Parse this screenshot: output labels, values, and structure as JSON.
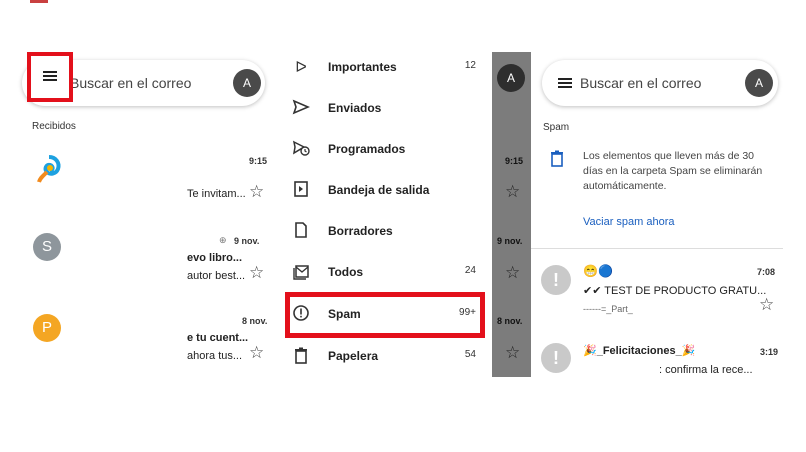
{
  "panel1": {
    "search_placeholder": "Buscar en el correo",
    "avatar": "A",
    "section": "Recibidos",
    "messages": [
      {
        "avatar": "",
        "time": "9:15",
        "subject": "",
        "snippet": "Te invitam..."
      },
      {
        "avatar": "S",
        "time": "9 nov.",
        "subject": "evo libro...",
        "snippet": "autor best..."
      },
      {
        "avatar": "P",
        "time": "8 nov.",
        "subject": "e tu cuent...",
        "snippet": "ahora tus..."
      }
    ]
  },
  "drawer": {
    "items": [
      {
        "icon": "importantes-icon",
        "label": "Importantes",
        "count": "12"
      },
      {
        "icon": "sent-icon",
        "label": "Enviados",
        "count": ""
      },
      {
        "icon": "scheduled-icon",
        "label": "Programados",
        "count": ""
      },
      {
        "icon": "outbox-icon",
        "label": "Bandeja de salida",
        "count": ""
      },
      {
        "icon": "draft-icon",
        "label": "Borradores",
        "count": ""
      },
      {
        "icon": "all-mail-icon",
        "label": "Todos",
        "count": "24"
      },
      {
        "icon": "spam-icon",
        "label": "Spam",
        "count": "99+"
      },
      {
        "icon": "trash-icon",
        "label": "Papelera",
        "count": "54"
      }
    ],
    "behind": {
      "time1": "9:15",
      "time2": "9 nov.",
      "time3": "8 nov."
    }
  },
  "panel3": {
    "search_placeholder": "Buscar en el correo",
    "avatar": "A",
    "section": "Spam",
    "notice": "Los elementos que lleven más de 30 días en la carpeta Spam se eliminarán automáticamente.",
    "action": "Vaciar spam ahora",
    "messages": [
      {
        "emoji": "😁🔵",
        "time": "7:08",
        "subject": "✔✔ TEST DE PRODUCTO GRATU...",
        "snippet": "------=_Part_"
      },
      {
        "emoji": "",
        "time": "3:19",
        "subject": "🎉_Felicitaciones_🎉",
        "snippet": ": confirma la rece..."
      }
    ]
  },
  "colors": {
    "highlight": "#e3101b",
    "link": "#1a5fbf"
  }
}
